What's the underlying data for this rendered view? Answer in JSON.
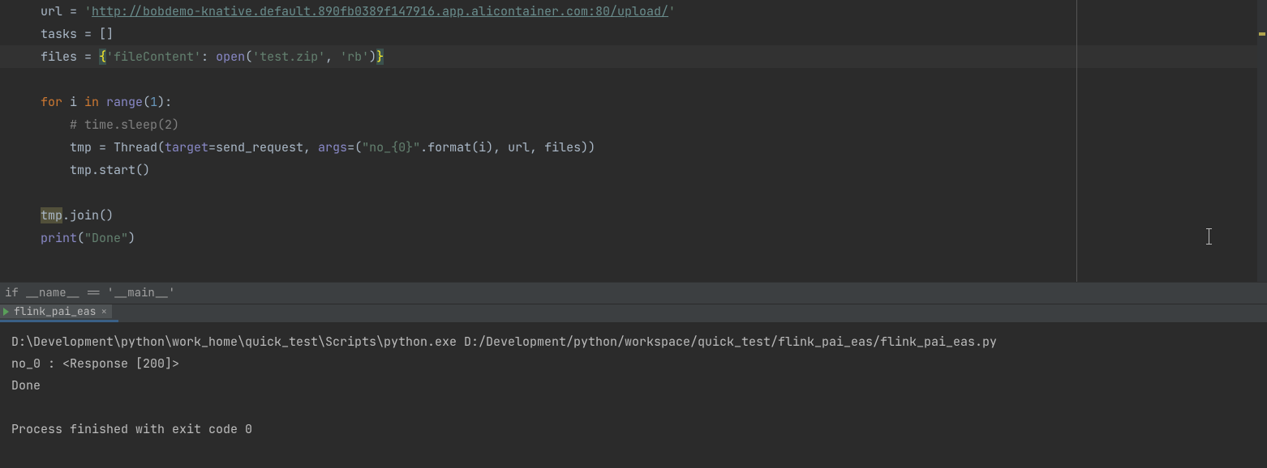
{
  "code": {
    "l1": {
      "a": "url = ",
      "b": "'",
      "c": "http://bobdemo-knative.default.890fb0389f147916.app.alicontainer.com:80/upload/",
      "d": "'"
    },
    "l2": "tasks = []",
    "l3": {
      "a": "files = ",
      "b": "{",
      "c": "'fileContent'",
      "d": ": ",
      "e": "open",
      "f": "(",
      "g": "'test.zip'",
      "h": ", ",
      "i": "'rb'",
      "j": ")",
      "k": "}"
    },
    "l5": {
      "a": "for ",
      "b": "i ",
      "c": "in ",
      "d": "range",
      "e": "(",
      "f": "1",
      "g": "):"
    },
    "l6": "# time.sleep(2)",
    "l7": {
      "a": "tmp = Thread(",
      "b": "target",
      "c": "=send_request, ",
      "d": "args",
      "e": "=(",
      "f": "\"no_{0}\"",
      "g": ".format(i), url, files))"
    },
    "l8": "tmp.start()",
    "l10": {
      "a": "tmp",
      "b": ".join()"
    },
    "l11": {
      "a": "print",
      "b": "(",
      "c": "\"Done\"",
      "d": ")"
    }
  },
  "breadcrumb": "if __name__ == '__main__'",
  "run": {
    "tab_label": "flink_pai_eas",
    "close_glyph": "×"
  },
  "console": {
    "l1": "D:\\Development\\python\\work_home\\quick_test\\Scripts\\python.exe D:/Development/python/workspace/quick_test/flink_pai_eas/flink_pai_eas.py",
    "l2": "no_0 : <Response [200]>",
    "l3": "Done",
    "l5": "Process finished with exit code 0"
  }
}
